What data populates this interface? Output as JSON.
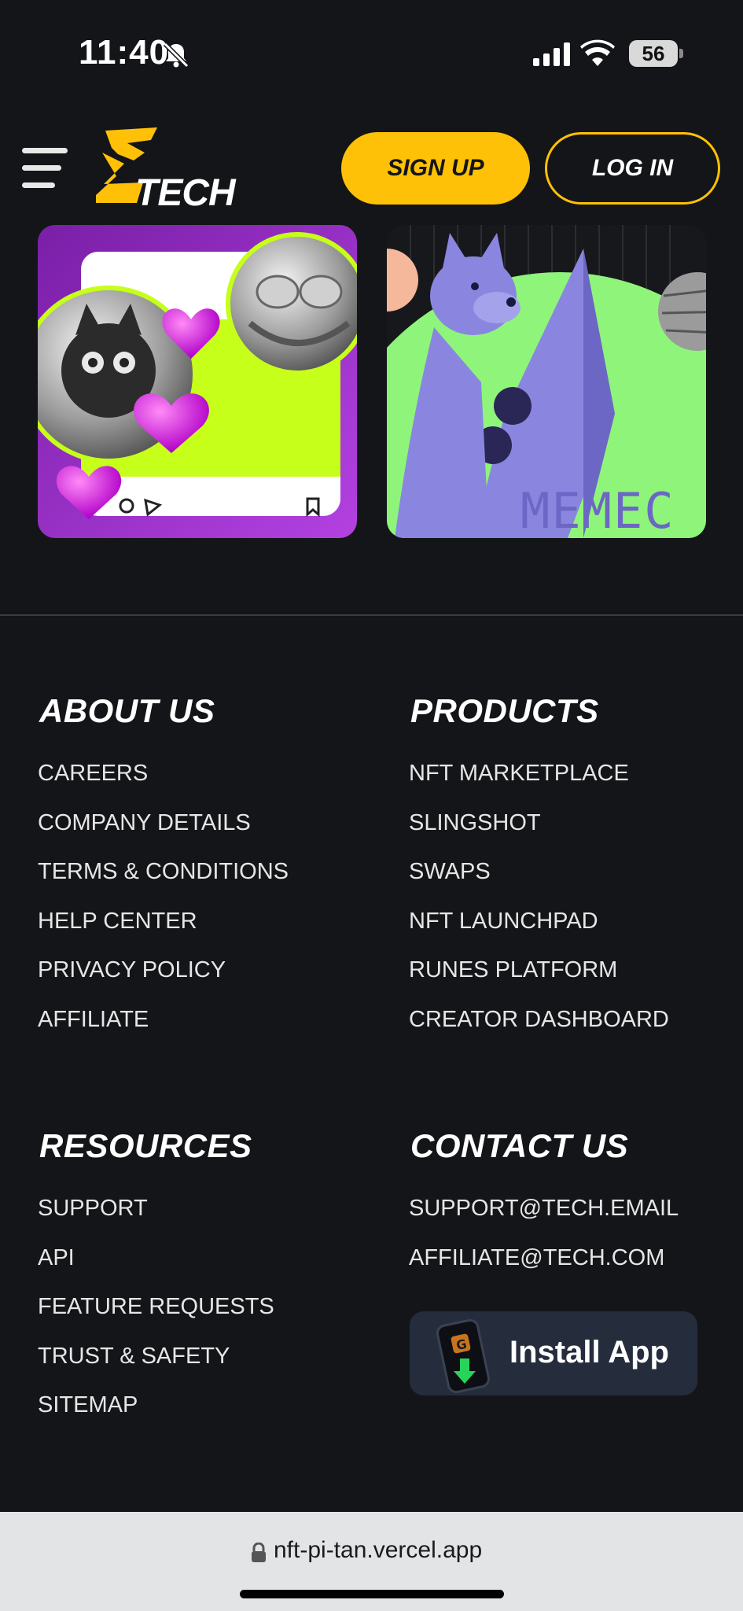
{
  "status_bar": {
    "time": "11:40",
    "battery": "56",
    "icons": [
      "bell-slash-icon",
      "signal-icon",
      "wifi-icon",
      "battery-icon"
    ]
  },
  "header": {
    "logo_text": "TECH",
    "signup_label": "SIGN UP",
    "login_label": "LOG IN",
    "accent_color": "#ffc107"
  },
  "cards": [
    {
      "name": "cat-frog-coins-nft"
    },
    {
      "name": "dog-rocket-meme-nft",
      "text": "MEMEC"
    }
  ],
  "footer": {
    "about": {
      "title": "ABOUT US",
      "links": [
        "CAREERS",
        "COMPANY DETAILS",
        "TERMS & CONDITIONS",
        "HELP CENTER",
        "PRIVACY POLICY",
        "AFFILIATE"
      ]
    },
    "products": {
      "title": "PRODUCTS",
      "links": [
        "NFT MARKETPLACE",
        "SLINGSHOT",
        "SWAPS",
        "NFT LAUNCHPAD",
        "RUNES PLATFORM",
        "CREATOR DASHBOARD"
      ]
    },
    "resources": {
      "title": "RESOURCES",
      "links": [
        "SUPPORT",
        "API",
        "FEATURE REQUESTS",
        "TRUST & SAFETY",
        "SITEMAP"
      ]
    },
    "contact": {
      "title": "CONTACT US",
      "emails": [
        "SUPPORT@TECH.EMAIL",
        "AFFILIATE@TECH.COM"
      ],
      "install_label": "Install App"
    }
  },
  "browser": {
    "url": "nft-pi-tan.vercel.app"
  },
  "colors": {
    "background": "#141518",
    "accent": "#ffc107",
    "text": "#ffffff",
    "link": "#e6e6e6"
  }
}
